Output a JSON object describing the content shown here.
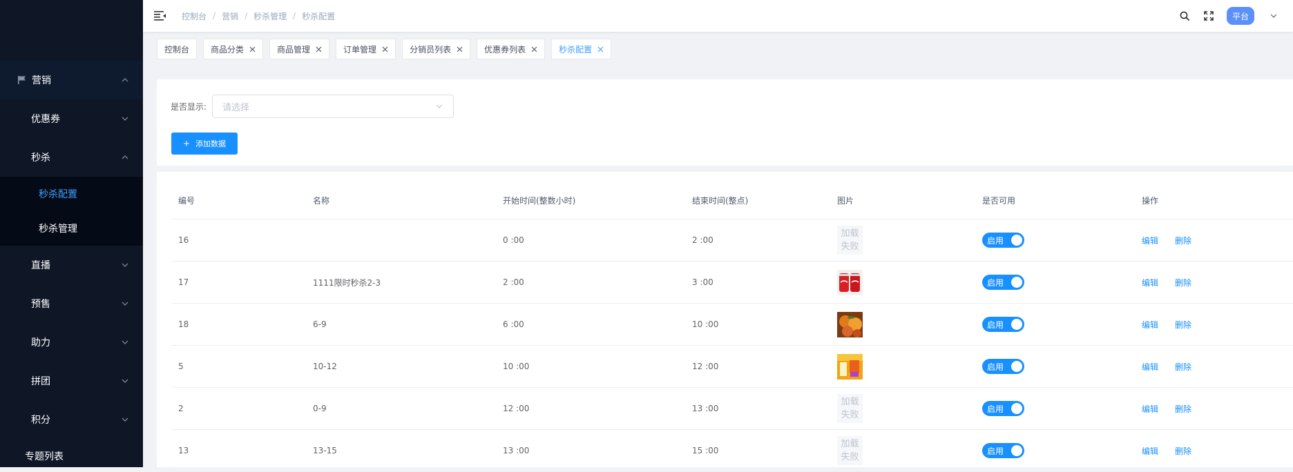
{
  "sidebar": {
    "top_section": "营销",
    "items": [
      {
        "label": "优惠券"
      },
      {
        "label": "秒杀",
        "children": [
          {
            "label": "秒杀配置",
            "active": true
          },
          {
            "label": "秒杀管理"
          }
        ]
      },
      {
        "label": "直播"
      },
      {
        "label": "预售"
      },
      {
        "label": "助力"
      },
      {
        "label": "拼团"
      },
      {
        "label": "积分"
      },
      {
        "label": "专题列表"
      }
    ]
  },
  "header": {
    "breadcrumb": [
      "控制台",
      "营销",
      "秒杀管理",
      "秒杀配置"
    ],
    "platform_label": "平台"
  },
  "tags": [
    {
      "label": "控制台",
      "closable": false
    },
    {
      "label": "商品分类",
      "closable": true
    },
    {
      "label": "商品管理",
      "closable": true
    },
    {
      "label": "订单管理",
      "closable": true
    },
    {
      "label": "分销员列表",
      "closable": true
    },
    {
      "label": "优惠券列表",
      "closable": true
    },
    {
      "label": "秒杀配置",
      "closable": true,
      "active": true
    }
  ],
  "filter": {
    "label": "是否显示:",
    "placeholder": "请选择"
  },
  "add_button": {
    "plus": "+",
    "label": "添加数据"
  },
  "table": {
    "columns": [
      "编号",
      "名称",
      "开始时间(整数小时)",
      "结束时间(整点)",
      "图片",
      "是否可用",
      "操作"
    ],
    "rows": [
      {
        "id": "16",
        "name": "",
        "start": "0 :00",
        "end": "2 :00",
        "image": "fail",
        "status": "启用",
        "edit": "编辑",
        "delete": "删除"
      },
      {
        "id": "17",
        "name": "1111限时秒杀2-3",
        "start": "2 :00",
        "end": "3 :00",
        "image": "cans",
        "status": "启用",
        "edit": "编辑",
        "delete": "删除"
      },
      {
        "id": "18",
        "name": "6-9",
        "start": "6 :00",
        "end": "10 :00",
        "image": "fruit",
        "status": "启用",
        "edit": "编辑",
        "delete": "删除"
      },
      {
        "id": "5",
        "name": "10-12",
        "start": "10 :00",
        "end": "12 :00",
        "image": "promo",
        "status": "启用",
        "edit": "编辑",
        "delete": "删除"
      },
      {
        "id": "2",
        "name": "0-9",
        "start": "12 :00",
        "end": "13 :00",
        "image": "fail",
        "status": "启用",
        "edit": "编辑",
        "delete": "删除"
      },
      {
        "id": "13",
        "name": "13-15",
        "start": "13 :00",
        "end": "15 :00",
        "image": "fail",
        "status": "启用",
        "edit": "编辑",
        "delete": "删除"
      }
    ],
    "image_fail_text": [
      "加载",
      "失败"
    ]
  },
  "colors": {
    "sidebar_bg": "#0f1727",
    "accent": "#1890ff",
    "active_menu": "#409eff",
    "platform_badge": "#5b8ff9"
  }
}
